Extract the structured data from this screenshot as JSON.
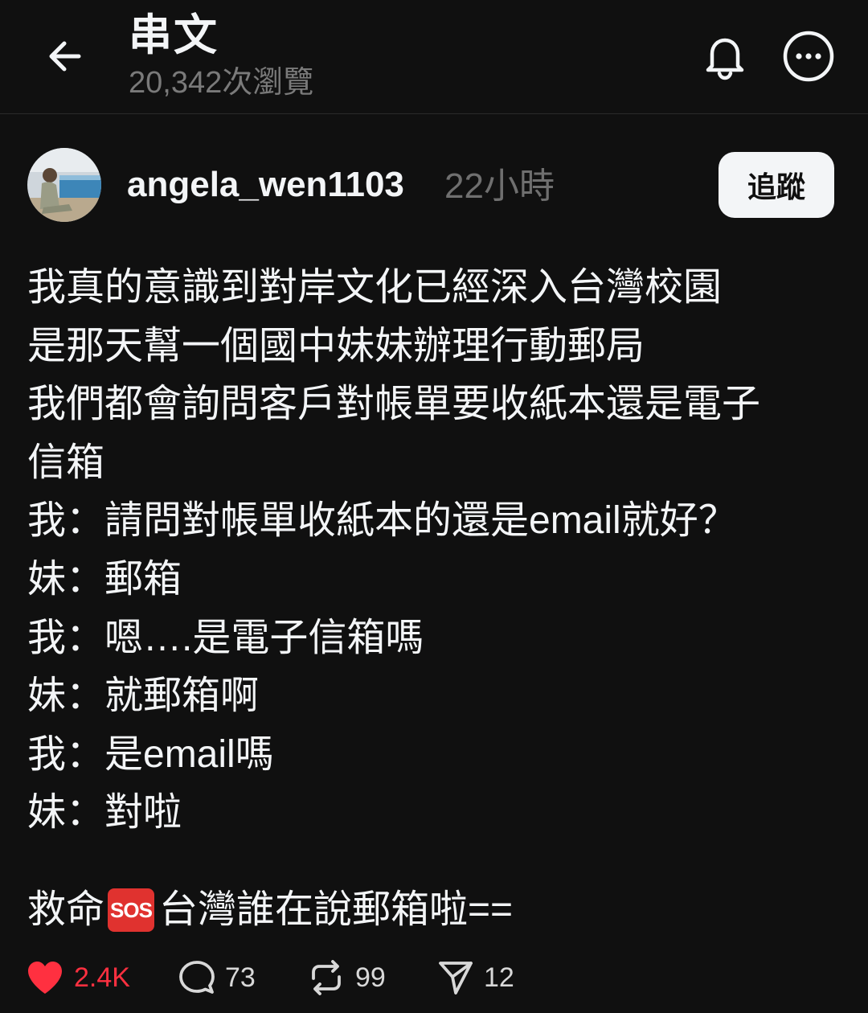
{
  "header": {
    "title": "串文",
    "views": "20,342次瀏覽",
    "icons": {
      "back": "arrow-left-icon",
      "notify": "bell-icon",
      "more": "more-horizontal-icon"
    }
  },
  "author": {
    "username": "angela_wen1103",
    "time": "22小時",
    "follow_label": "追蹤",
    "avatar": "avatar-photo"
  },
  "post": {
    "lines": [
      "我真的意識到對岸文化已經深入台灣校園",
      "是那天幫一個國中妹妹辦理行動郵局",
      "我們都會詢問客戶對帳單要收紙本還是電子",
      "信箱",
      "我：請問對帳單收紙本的還是email就好？",
      "妹：郵箱",
      "我：嗯….是電子信箱嗎",
      "妹：就郵箱啊",
      "我：是email嗎",
      "妹：對啦"
    ],
    "closing": {
      "before": "救命",
      "emoji": "SOS",
      "after": "台灣誰在說郵箱啦=="
    }
  },
  "actions": {
    "likes": "2.4K",
    "replies": "73",
    "reposts": "99",
    "shares": "12",
    "colors": {
      "liked": "#ff3040",
      "text": "#f3f5f7",
      "muted": "#7a7a7a",
      "background": "#101010"
    }
  }
}
